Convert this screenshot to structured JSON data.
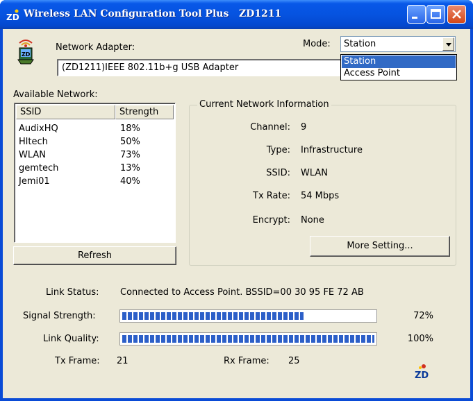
{
  "window": {
    "title": "Wireless LAN Configuration Tool Plus   ZD1211",
    "icon": "zd-logo-icon"
  },
  "adapter": {
    "label": "Network Adapter:",
    "value": "(ZD1211)IEEE 802.11b+g USB Adapter"
  },
  "mode": {
    "label": "Mode:",
    "value": "Station",
    "options": [
      "Station",
      "Access Point"
    ],
    "highlighted": "Station"
  },
  "networks": {
    "label": "Available Network:",
    "columns": [
      "SSID",
      "Strength"
    ],
    "rows": [
      {
        "ssid": "AudixHQ",
        "strength": "18%"
      },
      {
        "ssid": "Hltech",
        "strength": "50%"
      },
      {
        "ssid": "WLAN",
        "strength": "73%"
      },
      {
        "ssid": "gemtech",
        "strength": "13%"
      },
      {
        "ssid": "Jemi01",
        "strength": "40%"
      }
    ],
    "refresh_label": "Refresh"
  },
  "current": {
    "title": "Current Network Information",
    "fields": [
      {
        "label": "Channel:",
        "value": "9"
      },
      {
        "label": "Type:",
        "value": "Infrastructure"
      },
      {
        "label": "SSID:",
        "value": "WLAN"
      },
      {
        "label": "Tx Rate:",
        "value": "54 Mbps"
      },
      {
        "label": "Encrypt:",
        "value": "None"
      }
    ],
    "more_label": "More Setting..."
  },
  "status": {
    "link_label": "Link Status:",
    "link_value": "Connected to Access Point. BSSID=00 30 95 FE 72 AB",
    "signal_label": "Signal Strength:",
    "signal_percent": "72%",
    "signal_level": 0.72,
    "quality_label": "Link Quality:",
    "quality_percent": "100%",
    "quality_level": 1.0,
    "tx_label": "Tx Frame:",
    "tx_value": "21",
    "rx_label": "Rx Frame:",
    "rx_value": "25"
  },
  "colors": {
    "titlebar": "#0653e0",
    "selection": "#316ac5",
    "progress": "#2c5fc8",
    "face": "#ece9d8"
  }
}
